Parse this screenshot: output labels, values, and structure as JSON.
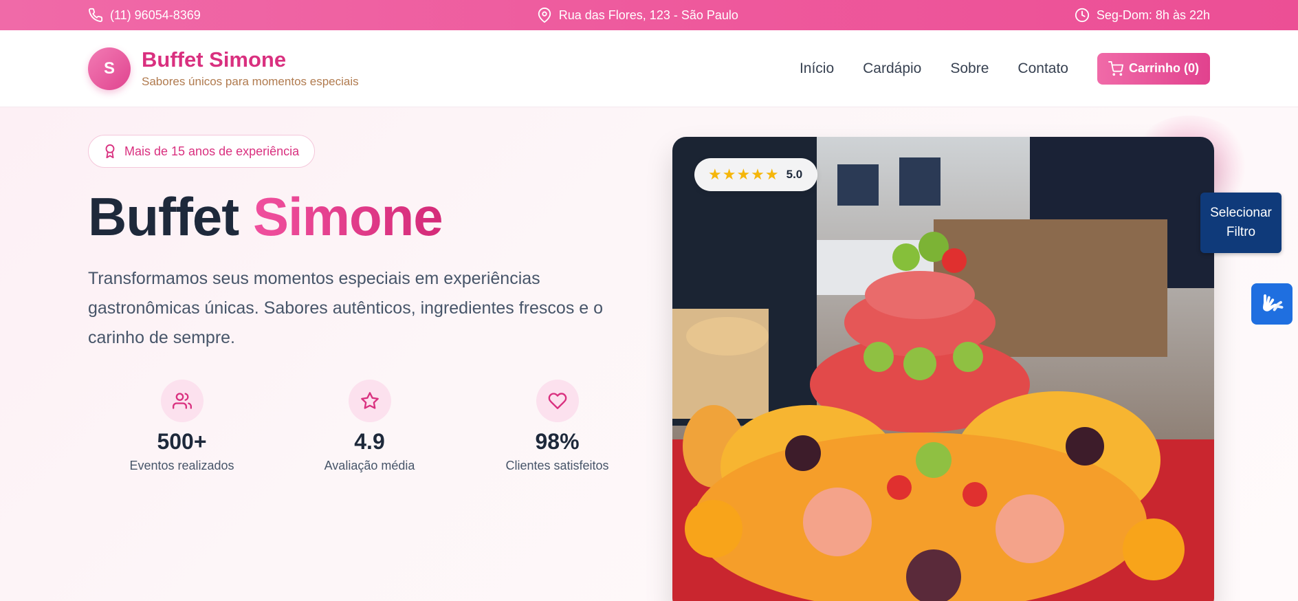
{
  "topbar": {
    "phone": "(11) 96054-8369",
    "address": "Rua das Flores, 123 - São Paulo",
    "hours": "Seg-Dom: 8h às 22h"
  },
  "brand": {
    "logo_letter": "S",
    "name": "Buffet Simone",
    "tagline": "Sabores únicos para momentos especiais"
  },
  "nav": {
    "items": [
      "Início",
      "Cardápio",
      "Sobre",
      "Contato"
    ],
    "cart_label": "Carrinho (0)"
  },
  "hero": {
    "badge": "Mais de 15 anos de experiência",
    "title_part1": "Buffet",
    "title_part2": "Simone",
    "description": "Transformamos seus momentos especiais em experiências gastronômicas únicas. Sabores autênticos, ingredientes frescos e o carinho de sempre.",
    "stats": [
      {
        "icon": "users-icon",
        "value": "500+",
        "label": "Eventos realizados"
      },
      {
        "icon": "star-icon",
        "value": "4.9",
        "label": "Avaliação média"
      },
      {
        "icon": "heart-icon",
        "value": "98%",
        "label": "Clientes satisfeitos"
      }
    ]
  },
  "rating": {
    "stars": "★★★★★",
    "value": "5.0"
  },
  "widgets": {
    "filter_label": "Selecionar Filtro"
  },
  "colors": {
    "brand_pink": "#d9307f",
    "accent_pink": "#f06aa8",
    "filter_blue": "#0f3a7a",
    "vlibras_blue": "#1f6fe0"
  }
}
